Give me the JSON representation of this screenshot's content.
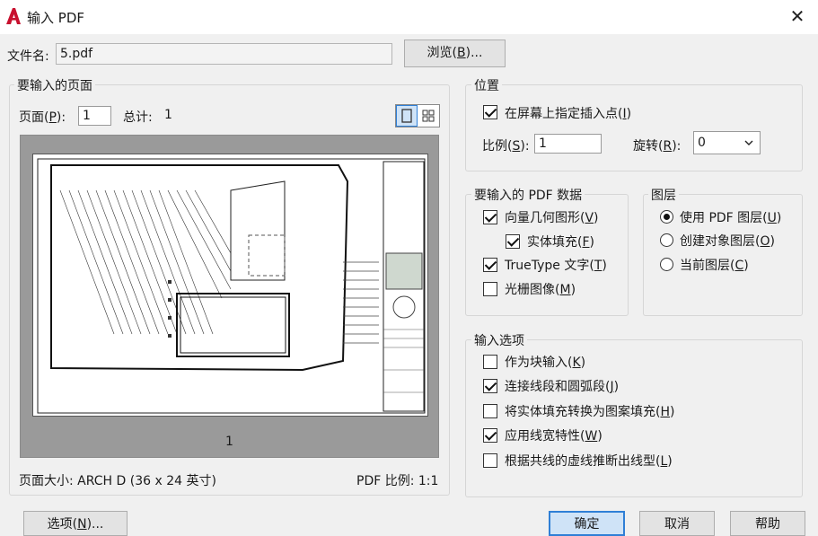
{
  "window": {
    "title": "输入 PDF",
    "close_glyph": "✕"
  },
  "file": {
    "label": "文件名:",
    "value": "5.pdf",
    "browse_label": "浏览(",
    "browse_key": "B",
    "browse_tail": ")..."
  },
  "pages": {
    "group_title": "要输入的页面",
    "page_label": "页面(",
    "page_key": "P",
    "page_tail": "):",
    "page_value": "1",
    "total_label": "总计:",
    "total_value": "1",
    "thumb_number": "1",
    "page_size": "页面大小: ARCH D (36 x 24 英寸)",
    "pdf_scale": "PDF 比例: 1:1"
  },
  "position": {
    "group_title": "位置",
    "onscreen_label": "在屏幕上指定插入点(",
    "onscreen_key": "I",
    "onscreen_tail": ")",
    "onscreen_checked": true,
    "scale_label": "比例(",
    "scale_key": "S",
    "scale_tail": "):",
    "scale_value": "1",
    "rotate_label": "旋转(",
    "rotate_key": "R",
    "rotate_tail": "):",
    "rotate_value": "0"
  },
  "pdfdata": {
    "group_title": "要输入的 PDF 数据",
    "items": [
      {
        "label": "向量几何图形(",
        "key": "V",
        "tail": ")",
        "checked": true
      },
      {
        "label": "实体填充(",
        "key": "F",
        "tail": ")",
        "checked": true
      },
      {
        "label": "TrueType 文字(",
        "key": "T",
        "tail": ")",
        "checked": true
      },
      {
        "label": "光栅图像(",
        "key": "M",
        "tail": ")",
        "checked": false
      }
    ]
  },
  "layers": {
    "group_title": "图层",
    "items": [
      {
        "label": "使用 PDF 图层(",
        "key": "U",
        "tail": ")",
        "selected": true
      },
      {
        "label": "创建对象图层(",
        "key": "O",
        "tail": ")",
        "selected": false
      },
      {
        "label": "当前图层(",
        "key": "C",
        "tail": ")",
        "selected": false
      }
    ]
  },
  "options": {
    "group_title": "输入选项",
    "items": [
      {
        "label": "作为块输入(",
        "key": "K",
        "tail": ")",
        "checked": false
      },
      {
        "label": "连接线段和圆弧段(",
        "key": "J",
        "tail": ")",
        "checked": true
      },
      {
        "label": "将实体填充转换为图案填充(",
        "key": "H",
        "tail": ")",
        "checked": false
      },
      {
        "label": "应用线宽特性(",
        "key": "W",
        "tail": ")",
        "checked": true
      },
      {
        "label": "根据共线的虚线推断出线型(",
        "key": "L",
        "tail": ")",
        "checked": false
      }
    ]
  },
  "buttons": {
    "options_label": "选项(",
    "options_key": "N",
    "options_tail": ")...",
    "ok_label": "确定",
    "cancel_label": "取消",
    "help_label": "帮助"
  },
  "colors": {
    "accent": "#2f7fd6",
    "logo": "#c8102e"
  },
  "icons": {
    "single_view": "single-page-view-icon",
    "grid_view": "thumbnail-grid-icon"
  }
}
